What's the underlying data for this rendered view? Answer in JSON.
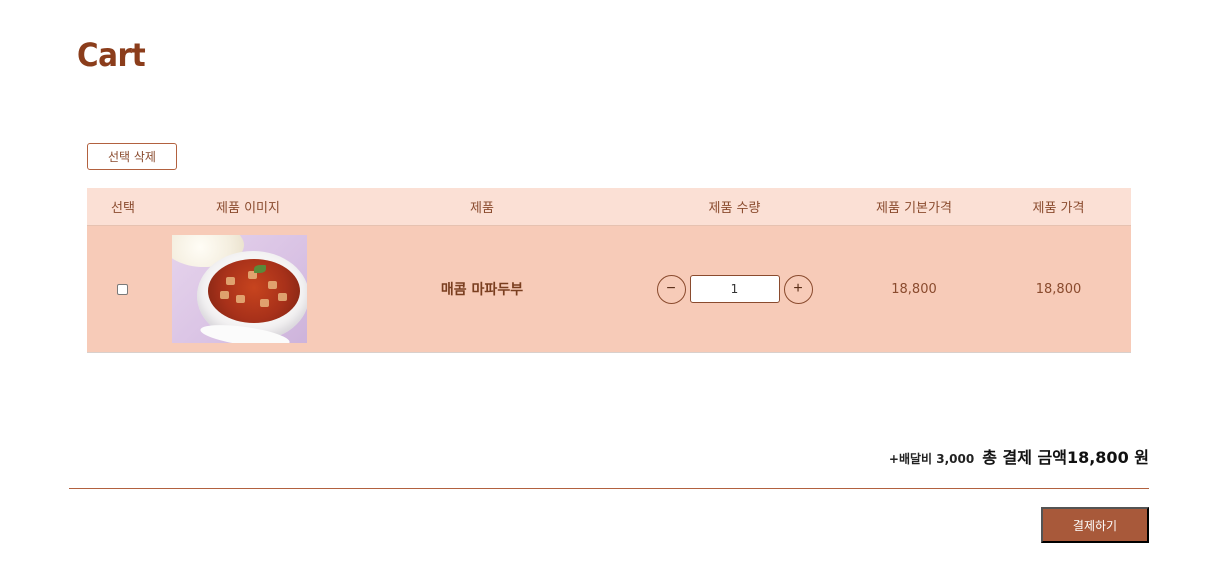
{
  "page": {
    "title": "Cart"
  },
  "actions": {
    "delete_selected": "선택 삭제",
    "checkout": "결제하기"
  },
  "table": {
    "headers": {
      "select": "선택",
      "image": "제품 이미지",
      "product": "제품",
      "quantity": "제품 수량",
      "base_price": "제품 기본가격",
      "price": "제품 가격"
    },
    "rows": [
      {
        "selected": false,
        "image_icon": "mapo-tofu-photo",
        "name": "매콤 마파두부",
        "quantity": "1",
        "base_price": "18,800",
        "price": "18,800"
      }
    ]
  },
  "quantity_controls": {
    "decrease": "−",
    "increase": "+"
  },
  "summary": {
    "delivery": "+배달비 3,000",
    "total_label": "총 결제 금액",
    "total_amount": "18,800 원"
  },
  "colors": {
    "brand": "#8b3d1b",
    "header_bg": "#fbe0d5",
    "row_bg": "#f7cbb8",
    "button_bg": "#a8593a"
  }
}
